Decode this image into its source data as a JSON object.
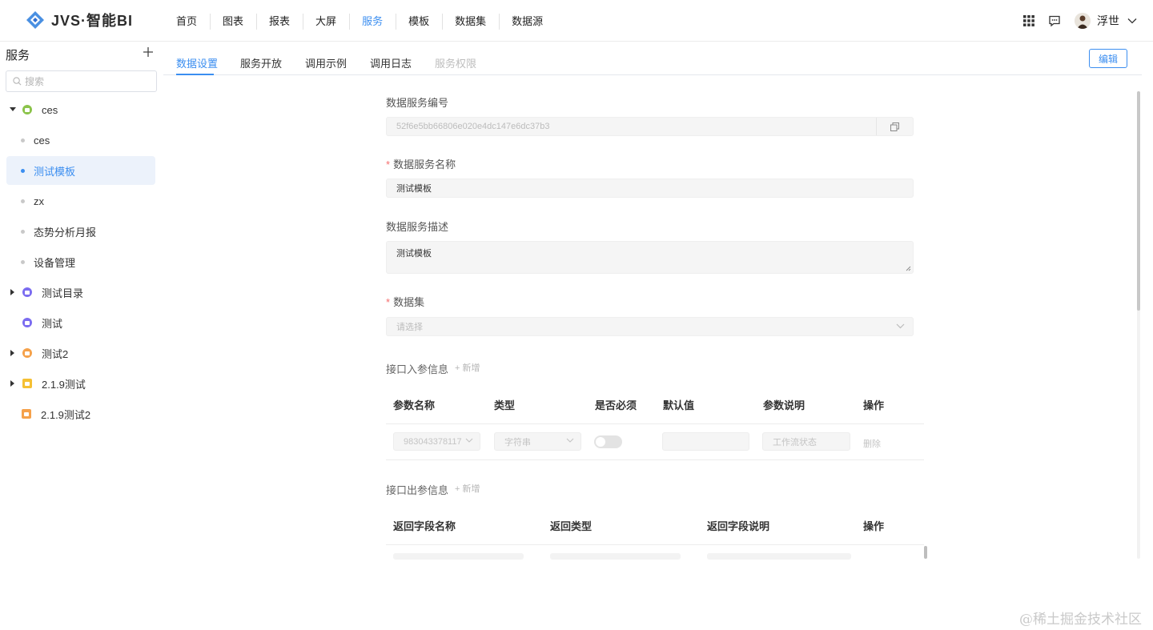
{
  "app": {
    "brand": "JVS·智能BI"
  },
  "nav": {
    "items": [
      "首页",
      "图表",
      "报表",
      "大屏",
      "服务",
      "模板",
      "数据集",
      "数据源"
    ],
    "active": "服务"
  },
  "user": {
    "name": "浮世"
  },
  "header_icons": [
    "apps-grid-icon",
    "message-icon"
  ],
  "sidebar": {
    "title": "服务",
    "search_placeholder": "搜索",
    "tree": [
      {
        "label": "ces",
        "type": "folder",
        "expanded": true,
        "color": "#8bc34a"
      },
      {
        "label": "ces",
        "type": "leaf"
      },
      {
        "label": "测试模板",
        "type": "leaf",
        "active": true
      },
      {
        "label": "zx",
        "type": "leaf"
      },
      {
        "label": "态势分析月报",
        "type": "leaf"
      },
      {
        "label": "设备管理",
        "type": "leaf"
      },
      {
        "label": "测试目录",
        "type": "folder",
        "expanded": false,
        "color": "#7b6cf0"
      },
      {
        "label": "测试",
        "type": "item",
        "color": "#7b6cf0"
      },
      {
        "label": "测试2",
        "type": "folder",
        "expanded": false,
        "color": "#f5a14a"
      },
      {
        "label": "2.1.9测试",
        "type": "folder",
        "expanded": false,
        "color": "#f5c033"
      },
      {
        "label": "2.1.9测试2",
        "type": "item",
        "color": "#f5a14a"
      }
    ]
  },
  "tabs": {
    "items": [
      "数据设置",
      "服务开放",
      "调用示例",
      "调用日志",
      "服务权限"
    ],
    "active": "数据设置",
    "disabled": "服务权限"
  },
  "actions": {
    "edit": "编辑"
  },
  "form": {
    "service_id_label": "数据服务编号",
    "service_id_value": "52f6e5bb66806e020e4dc147e6dc37b3",
    "service_name_label": "数据服务名称",
    "service_name_value": "测试模板",
    "service_desc_label": "数据服务描述",
    "service_desc_value": "测试模板",
    "dataset_label": "数据集",
    "dataset_placeholder": "请选择"
  },
  "input_params": {
    "title": "接口入参信息",
    "add": "新增",
    "columns": [
      "参数名称",
      "类型",
      "是否必须",
      "默认值",
      "参数说明",
      "操作"
    ],
    "row": {
      "name": "983043378117",
      "type": "字符串",
      "required": false,
      "default": "",
      "desc_placeholder": "工作流状态",
      "action": "删除"
    }
  },
  "output_params": {
    "title": "接口出参信息",
    "add": "新增",
    "columns": [
      "返回字段名称",
      "返回类型",
      "返回字段说明",
      "操作"
    ]
  },
  "watermark": "@稀土掘金技术社区"
}
